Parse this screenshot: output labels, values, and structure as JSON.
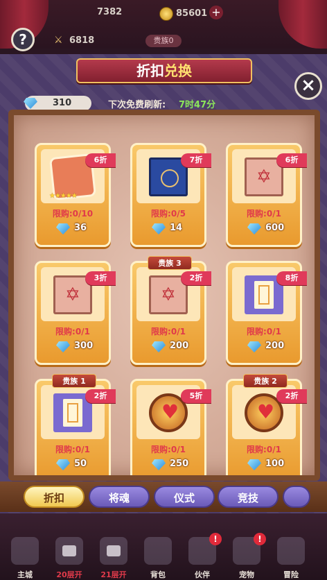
{
  "topbar": {
    "stat1": "7382",
    "gold": "85601",
    "power": "6818",
    "rank": "贵族0",
    "help_label": "?"
  },
  "modal": {
    "title_a": "折扣",
    "title_b": "兑换",
    "close_label": "×",
    "gems": "310",
    "refresh_label": "下次免费刷新:",
    "refresh_time": "7时47分"
  },
  "cards": [
    {
      "item": "puzzle",
      "discount": "6折",
      "vip": "",
      "limit": "限购:0/10",
      "cost": "36",
      "stars": "★★★★★"
    },
    {
      "item": "book",
      "discount": "7折",
      "vip": "",
      "limit": "限购:0/5",
      "cost": "14",
      "stars": ""
    },
    {
      "item": "tome",
      "discount": "6折",
      "vip": "",
      "limit": "限购:0/1",
      "cost": "600",
      "stars": ""
    },
    {
      "item": "tome",
      "discount": "3折",
      "vip": "",
      "limit": "限购:0/1",
      "cost": "300",
      "stars": ""
    },
    {
      "item": "tome",
      "discount": "2折",
      "vip": "贵族 3",
      "limit": "限购:0/1",
      "cost": "200",
      "stars": ""
    },
    {
      "item": "scroll",
      "discount": "8折",
      "vip": "",
      "limit": "限购:0/1",
      "cost": "200",
      "stars": ""
    },
    {
      "item": "scroll",
      "discount": "2折",
      "vip": "贵族 1",
      "limit": "限购:0/1",
      "cost": "50",
      "stars": ""
    },
    {
      "item": "token",
      "discount": "5折",
      "vip": "",
      "limit": "限购:0/1",
      "cost": "250",
      "stars": ""
    },
    {
      "item": "token",
      "discount": "2折",
      "vip": "贵族 2",
      "limit": "限购:0/1",
      "cost": "100",
      "stars": ""
    }
  ],
  "tabs": [
    {
      "label": "折扣",
      "active": true
    },
    {
      "label": "将魂",
      "active": false
    },
    {
      "label": "仪式",
      "active": false
    },
    {
      "label": "竞技",
      "active": false
    }
  ],
  "nav": [
    {
      "label": "主城",
      "color": "#e8e0d8",
      "locked": false,
      "badge": ""
    },
    {
      "label": "20层开",
      "color": "#e03a4a",
      "locked": true,
      "badge": ""
    },
    {
      "label": "21层开",
      "color": "#e03a4a",
      "locked": true,
      "badge": ""
    },
    {
      "label": "背包",
      "color": "#e8e0d8",
      "locked": false,
      "badge": ""
    },
    {
      "label": "伙伴",
      "color": "#e8e0d8",
      "locked": false,
      "badge": "!"
    },
    {
      "label": "宠物",
      "color": "#e8e0d8",
      "locked": false,
      "badge": "!"
    },
    {
      "label": "冒险",
      "color": "#e8e0d8",
      "locked": false,
      "badge": ""
    }
  ]
}
